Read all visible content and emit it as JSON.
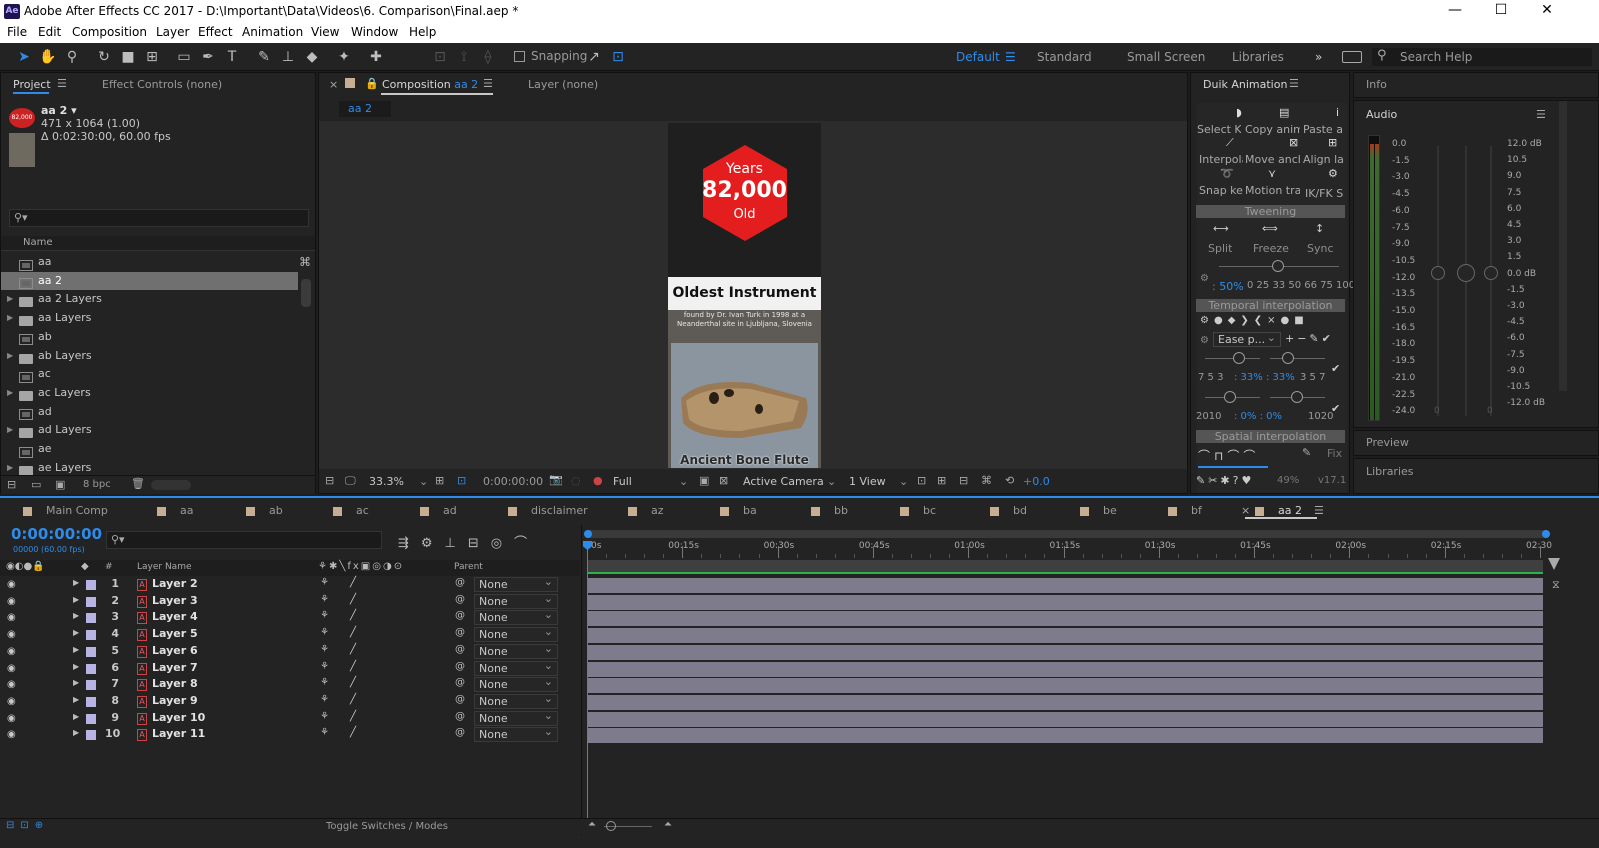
{
  "titlebar": {
    "app_icon": "Ae",
    "title": "Adobe After Effects CC 2017 - D:\\Important\\Data\\Videos\\6. Comparison\\Final.aep *",
    "minimize": "—",
    "maximize": "☐",
    "close": "✕"
  },
  "menu": [
    "File",
    "Edit",
    "Composition",
    "Layer",
    "Effect",
    "Animation",
    "View",
    "Window",
    "Help"
  ],
  "toolbar": {
    "snapping": "Snapping",
    "workspaces": [
      "Default",
      "Standard",
      "Small Screen",
      "Libraries"
    ],
    "more": "»",
    "search_placeholder": "Search Help"
  },
  "project": {
    "tab_project": "Project",
    "tab_effect_controls": "Effect Controls (none)",
    "selected_name": "aa 2",
    "selected_dims": "471 x 1064 (1.00)",
    "selected_duration": "Δ 0:02:30:00, 60.00 fps",
    "search_placeholder": "",
    "column_name": "Name",
    "items": [
      {
        "name": "aa",
        "type": "comp",
        "expand": false
      },
      {
        "name": "aa 2",
        "type": "comp",
        "expand": false,
        "selected": true
      },
      {
        "name": "aa 2 Layers",
        "type": "folder",
        "expand": true
      },
      {
        "name": "aa Layers",
        "type": "folder",
        "expand": true
      },
      {
        "name": "ab",
        "type": "comp",
        "expand": false
      },
      {
        "name": "ab Layers",
        "type": "folder",
        "expand": true
      },
      {
        "name": "ac",
        "type": "comp",
        "expand": false
      },
      {
        "name": "ac Layers",
        "type": "folder",
        "expand": true
      },
      {
        "name": "ad",
        "type": "comp",
        "expand": false
      },
      {
        "name": "ad Layers",
        "type": "folder",
        "expand": true
      },
      {
        "name": "ae",
        "type": "comp",
        "expand": false
      },
      {
        "name": "ae Layers",
        "type": "folder",
        "expand": true
      }
    ],
    "bpc": "8 bpc"
  },
  "composition": {
    "tab_label": "Composition",
    "tab_comp": "aa 2",
    "tab_layer": "Layer (none)",
    "breadcrumb": "aa 2",
    "zoom": "33.3%",
    "timecode": "0:00:00:00",
    "resolution": "Full",
    "camera": "Active Camera",
    "views": "1 View",
    "exposure": "+0.0",
    "artwork": {
      "years": "Years",
      "number": "82,000",
      "old": "Old",
      "heading": "Oldest Instrument",
      "sub": "found by Dr. Ivan Turk in 1998 at a Neanderthal site in Ljubljana, Slovenia",
      "caption": "Ancient Bone Flute"
    }
  },
  "duik": {
    "title": "Duik Animation",
    "row1": [
      "Select Ke",
      "Copy anim",
      "Paste a"
    ],
    "row2": [
      "Interpola",
      "Move anch",
      "Align la"
    ],
    "row3": [
      "Snap key",
      "Motion trai",
      "IK/FK S"
    ],
    "tweening": "Tweening",
    "tween_btns": [
      "Split",
      "Freeze",
      "Sync"
    ],
    "influence": ": 50%",
    "presets": "0 25 33 50 66 75 100",
    "temporal": "Temporal interpolation",
    "ease": "Ease p...",
    "vals1_left": "7 5 3",
    "vals1_mid": ": 33% : 33%",
    "vals1_right": "3 5 7",
    "vals2_left": "2010",
    "vals2_mid": ": 0% : 0%",
    "vals2_right": "1020",
    "spatial": "Spatial interpolation",
    "fix": "Fix",
    "percent": "49%",
    "version": "v17.1"
  },
  "right_panels": {
    "info": "Info",
    "audio": "Audio",
    "db_left": [
      "0.0",
      "-1.5",
      "-3.0",
      "-4.5",
      "-6.0",
      "-7.5",
      "-9.0",
      "-10.5",
      "-12.0",
      "-13.5",
      "-15.0",
      "-16.5",
      "-18.0",
      "-19.5",
      "-21.0",
      "-22.5",
      "-24.0"
    ],
    "db_right": [
      "12.0 dB",
      "10.5",
      "9.0",
      "7.5",
      "6.0",
      "4.5",
      "3.0",
      "1.5",
      "0.0 dB",
      "-1.5",
      "-3.0",
      "-4.5",
      "-6.0",
      "-7.5",
      "-9.0",
      "-10.5",
      "-12.0 dB"
    ],
    "slider_zero_left": "0",
    "slider_zero_right": "0",
    "preview": "Preview",
    "libraries": "Libraries"
  },
  "timeline": {
    "tabs": [
      "Main Comp",
      "aa",
      "ab",
      "ac",
      "ad",
      "disclaimer",
      "az",
      "ba",
      "bb",
      "bc",
      "bd",
      "be",
      "bf",
      "aa 2"
    ],
    "active_tab": "aa 2",
    "timecode": "0:00:00:00",
    "frames": "00000 (60.00 fps)",
    "col_layer_name": "Layer Name",
    "col_parent": "Parent",
    "col_num": "#",
    "ruler": [
      "0s",
      "00:15s",
      "00:30s",
      "00:45s",
      "01:00s",
      "01:15s",
      "01:30s",
      "01:45s",
      "02:00s",
      "02:15s",
      "02:30"
    ],
    "layers": [
      {
        "num": "1",
        "name": "Layer 2",
        "parent": "None"
      },
      {
        "num": "2",
        "name": "Layer 3",
        "parent": "None"
      },
      {
        "num": "3",
        "name": "Layer 4",
        "parent": "None"
      },
      {
        "num": "4",
        "name": "Layer 5",
        "parent": "None"
      },
      {
        "num": "5",
        "name": "Layer 6",
        "parent": "None"
      },
      {
        "num": "6",
        "name": "Layer 7",
        "parent": "None"
      },
      {
        "num": "7",
        "name": "Layer 8",
        "parent": "None"
      },
      {
        "num": "8",
        "name": "Layer 9",
        "parent": "None"
      },
      {
        "num": "9",
        "name": "Layer 10",
        "parent": "None"
      },
      {
        "num": "10",
        "name": "Layer 11",
        "parent": "None"
      }
    ],
    "toggle": "Toggle Switches / Modes"
  }
}
